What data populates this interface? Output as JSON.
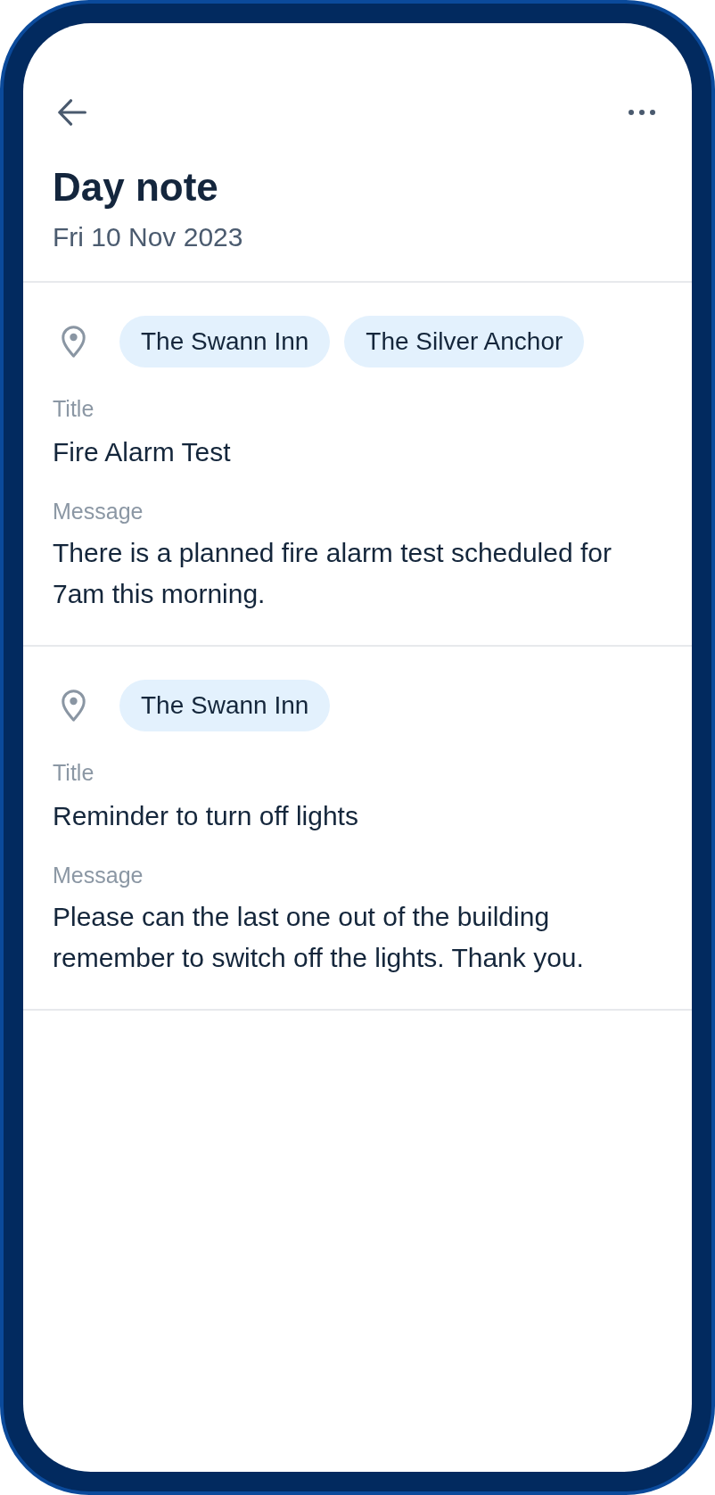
{
  "header": {
    "title": "Day note",
    "date": "Fri 10 Nov 2023"
  },
  "notes": [
    {
      "locations": [
        "The Swann Inn",
        "The Silver Anchor"
      ],
      "title_label": "Title",
      "title": "Fire Alarm Test",
      "message_label": "Message",
      "message": "There is a planned fire alarm test scheduled for 7am this morning."
    },
    {
      "locations": [
        "The Swann Inn"
      ],
      "title_label": "Title",
      "title": "Reminder to turn off lights",
      "message_label": "Message",
      "message": "Please can the last one out of the building remember to switch off the lights. Thank you."
    }
  ]
}
